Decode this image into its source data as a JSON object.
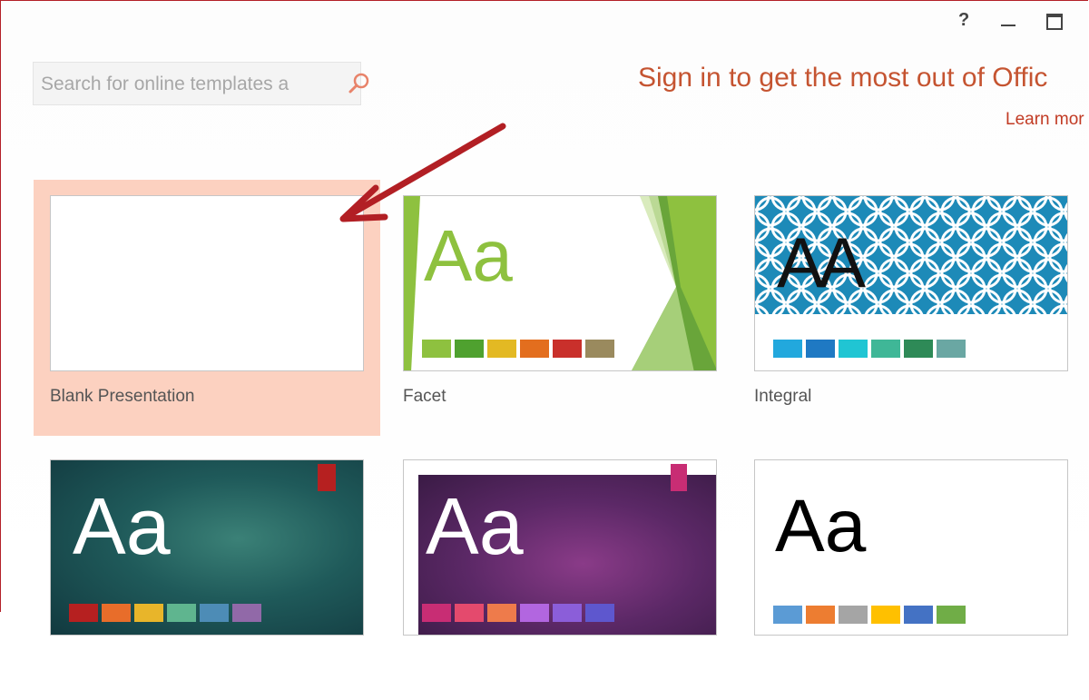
{
  "window": {
    "help_label": "?",
    "minimize_label": "minimize",
    "maximize_label": "maximize"
  },
  "search": {
    "placeholder": "Search for online templates a",
    "icon": "search-icon",
    "icon_color": "#e8836a"
  },
  "signin": {
    "text": "Sign in to get the most out of Offic",
    "learn_more": "Learn mor"
  },
  "colors": {
    "accent": "#c55431",
    "selected_bg": "#fcd1c0",
    "arrow": "#b21f24"
  },
  "templates": [
    {
      "name": "Blank Presentation",
      "selected": true
    },
    {
      "name": "Facet",
      "aa": "Aa",
      "swatches": [
        "#8ec13f",
        "#4fa12f",
        "#e3b923",
        "#e36e1e",
        "#c9302b",
        "#9a8a5e"
      ]
    },
    {
      "name": "Integral",
      "aa": "AA",
      "swatches": [
        "#22a8dd",
        "#1f79c3",
        "#20c5d3",
        "#3fb797",
        "#2e8a57",
        "#6aa7a3"
      ]
    },
    {
      "name": "",
      "aa": "Aa",
      "swatches": [
        "#b62020",
        "#e86d2a",
        "#e8b52a",
        "#5fb58f",
        "#4d8cb6",
        "#9169a8"
      ]
    },
    {
      "name": "",
      "aa": "Aa",
      "swatches": [
        "#c82d74",
        "#e44a6d",
        "#ee7b4b",
        "#b266e0",
        "#8b5ed9",
        "#5e57ce"
      ]
    },
    {
      "name": "",
      "aa": "Aa",
      "swatches": [
        "#5b9bd5",
        "#ed7d31",
        "#a5a5a5",
        "#ffc000",
        "#4472c4",
        "#70ad47"
      ]
    }
  ]
}
